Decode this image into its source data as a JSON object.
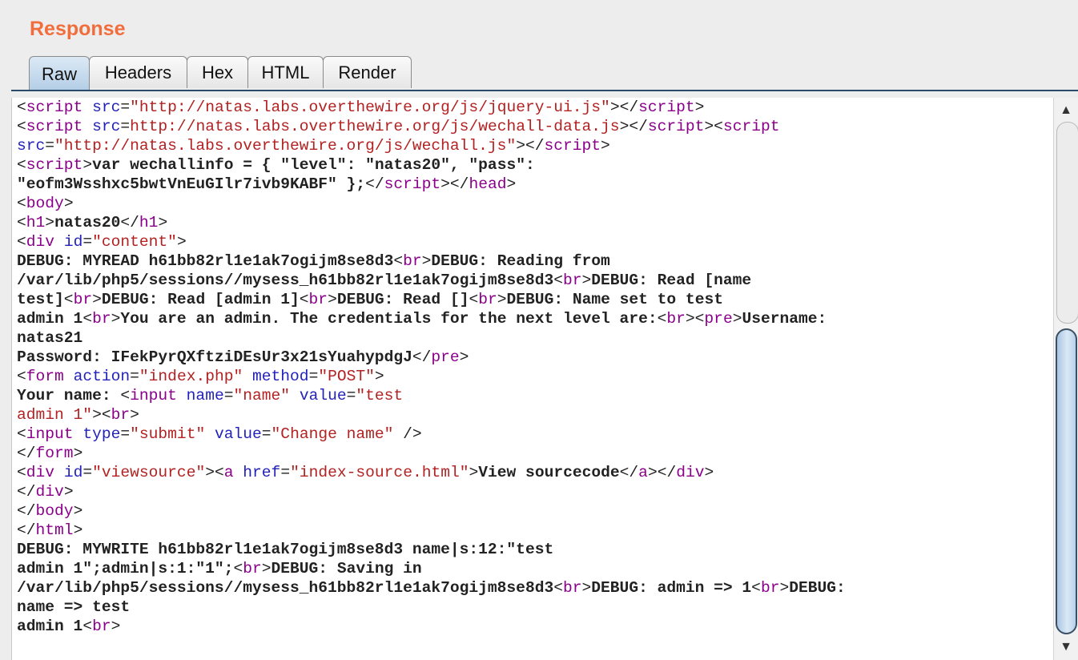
{
  "panel": {
    "title": "Response"
  },
  "tabs": [
    {
      "label": "Raw",
      "active": true
    },
    {
      "label": "Headers",
      "active": false
    },
    {
      "label": "Hex",
      "active": false
    },
    {
      "label": "HTML",
      "active": false
    },
    {
      "label": "Render",
      "active": false
    }
  ],
  "colors": {
    "title": "#f16e3c",
    "tag": "#8b008b",
    "attr": "#2222bb",
    "value": "#b22222",
    "text": "#222222"
  },
  "scrollbar": {
    "up_icon": "▲",
    "down_icon": "▼"
  },
  "code_lines": [
    [
      [
        "p",
        "<"
      ],
      [
        "t",
        "script"
      ],
      [
        "p",
        " "
      ],
      [
        "a",
        "src"
      ],
      [
        "p",
        "="
      ],
      [
        "v",
        "\"http://natas.labs.overthewire.org/js/jquery-ui.js\""
      ],
      [
        "p",
        "></"
      ],
      [
        "t",
        "script"
      ],
      [
        "p",
        ">"
      ]
    ],
    [
      [
        "p",
        "<"
      ],
      [
        "t",
        "script"
      ],
      [
        "p",
        " "
      ],
      [
        "a",
        "src"
      ],
      [
        "p",
        "="
      ],
      [
        "v",
        "http://natas.labs.overthewire.org/js/wechall-data.js"
      ],
      [
        "p",
        "></"
      ],
      [
        "t",
        "script"
      ],
      [
        "p",
        "><"
      ],
      [
        "t",
        "script"
      ]
    ],
    [
      [
        "a",
        "src"
      ],
      [
        "p",
        "="
      ],
      [
        "v",
        "\"http://natas.labs.overthewire.org/js/wechall.js\""
      ],
      [
        "p",
        "></"
      ],
      [
        "t",
        "script"
      ],
      [
        "p",
        ">"
      ]
    ],
    [
      [
        "p",
        "<"
      ],
      [
        "t",
        "script"
      ],
      [
        "p",
        ">"
      ],
      [
        "x",
        "var wechallinfo = { \"level\": \"natas20\", \"pass\":"
      ]
    ],
    [
      [
        "x",
        "\"eofm3Wsshxc5bwtVnEuGIlr7ivb9KABF\" };"
      ],
      [
        "p",
        "</"
      ],
      [
        "t",
        "script"
      ],
      [
        "p",
        "></"
      ],
      [
        "t",
        "head"
      ],
      [
        "p",
        ">"
      ]
    ],
    [
      [
        "p",
        "<"
      ],
      [
        "t",
        "body"
      ],
      [
        "p",
        ">"
      ]
    ],
    [
      [
        "p",
        "<"
      ],
      [
        "t",
        "h1"
      ],
      [
        "p",
        ">"
      ],
      [
        "x",
        "natas20"
      ],
      [
        "p",
        "</"
      ],
      [
        "t",
        "h1"
      ],
      [
        "p",
        ">"
      ]
    ],
    [
      [
        "p",
        "<"
      ],
      [
        "t",
        "div"
      ],
      [
        "p",
        " "
      ],
      [
        "a",
        "id"
      ],
      [
        "p",
        "="
      ],
      [
        "v",
        "\"content\""
      ],
      [
        "p",
        ">"
      ]
    ],
    [
      [
        "x",
        "DEBUG: MYREAD h61bb82rl1e1ak7ogijm8se8d3"
      ],
      [
        "p",
        "<"
      ],
      [
        "t",
        "br"
      ],
      [
        "p",
        ">"
      ],
      [
        "x",
        "DEBUG: Reading from"
      ]
    ],
    [
      [
        "x",
        "/var/lib/php5/sessions//mysess_h61bb82rl1e1ak7ogijm8se8d3"
      ],
      [
        "p",
        "<"
      ],
      [
        "t",
        "br"
      ],
      [
        "p",
        ">"
      ],
      [
        "x",
        "DEBUG: Read [name"
      ]
    ],
    [
      [
        "x",
        "test]"
      ],
      [
        "p",
        "<"
      ],
      [
        "t",
        "br"
      ],
      [
        "p",
        ">"
      ],
      [
        "x",
        "DEBUG: Read [admin 1]"
      ],
      [
        "p",
        "<"
      ],
      [
        "t",
        "br"
      ],
      [
        "p",
        ">"
      ],
      [
        "x",
        "DEBUG: Read []"
      ],
      [
        "p",
        "<"
      ],
      [
        "t",
        "br"
      ],
      [
        "p",
        ">"
      ],
      [
        "x",
        "DEBUG: Name set to test"
      ]
    ],
    [
      [
        "x",
        "admin 1"
      ],
      [
        "p",
        "<"
      ],
      [
        "t",
        "br"
      ],
      [
        "p",
        ">"
      ],
      [
        "x",
        "You are an admin. The credentials for the next level are:"
      ],
      [
        "p",
        "<"
      ],
      [
        "t",
        "br"
      ],
      [
        "p",
        "><"
      ],
      [
        "t",
        "pre"
      ],
      [
        "p",
        ">"
      ],
      [
        "x",
        "Username:"
      ]
    ],
    [
      [
        "x",
        "natas21"
      ]
    ],
    [
      [
        "x",
        "Password: IFekPyrQXftziDEsUr3x21sYuahypdgJ"
      ],
      [
        "p",
        "</"
      ],
      [
        "t",
        "pre"
      ],
      [
        "p",
        ">"
      ]
    ],
    [
      [
        "p",
        "<"
      ],
      [
        "t",
        "form"
      ],
      [
        "p",
        " "
      ],
      [
        "a",
        "action"
      ],
      [
        "p",
        "="
      ],
      [
        "v",
        "\"index.php\""
      ],
      [
        "p",
        " "
      ],
      [
        "a",
        "method"
      ],
      [
        "p",
        "="
      ],
      [
        "v",
        "\"POST\""
      ],
      [
        "p",
        ">"
      ]
    ],
    [
      [
        "x",
        "Your name: "
      ],
      [
        "p",
        "<"
      ],
      [
        "t",
        "input"
      ],
      [
        "p",
        " "
      ],
      [
        "a",
        "name"
      ],
      [
        "p",
        "="
      ],
      [
        "v",
        "\"name\""
      ],
      [
        "p",
        " "
      ],
      [
        "a",
        "value"
      ],
      [
        "p",
        "="
      ],
      [
        "v",
        "\"test"
      ]
    ],
    [
      [
        "v",
        "admin 1\""
      ],
      [
        "p",
        "><"
      ],
      [
        "t",
        "br"
      ],
      [
        "p",
        ">"
      ]
    ],
    [
      [
        "p",
        "<"
      ],
      [
        "t",
        "input"
      ],
      [
        "p",
        " "
      ],
      [
        "a",
        "type"
      ],
      [
        "p",
        "="
      ],
      [
        "v",
        "\"submit\""
      ],
      [
        "p",
        " "
      ],
      [
        "a",
        "value"
      ],
      [
        "p",
        "="
      ],
      [
        "v",
        "\"Change name\""
      ],
      [
        "p",
        " />"
      ]
    ],
    [
      [
        "p",
        "</"
      ],
      [
        "t",
        "form"
      ],
      [
        "p",
        ">"
      ]
    ],
    [
      [
        "p",
        "<"
      ],
      [
        "t",
        "div"
      ],
      [
        "p",
        " "
      ],
      [
        "a",
        "id"
      ],
      [
        "p",
        "="
      ],
      [
        "v",
        "\"viewsource\""
      ],
      [
        "p",
        "><"
      ],
      [
        "t",
        "a"
      ],
      [
        "p",
        " "
      ],
      [
        "a",
        "href"
      ],
      [
        "p",
        "="
      ],
      [
        "v",
        "\"index-source.html\""
      ],
      [
        "p",
        ">"
      ],
      [
        "x",
        "View sourcecode"
      ],
      [
        "p",
        "</"
      ],
      [
        "t",
        "a"
      ],
      [
        "p",
        "></"
      ],
      [
        "t",
        "div"
      ],
      [
        "p",
        ">"
      ]
    ],
    [
      [
        "p",
        "</"
      ],
      [
        "t",
        "div"
      ],
      [
        "p",
        ">"
      ]
    ],
    [
      [
        "p",
        "</"
      ],
      [
        "t",
        "body"
      ],
      [
        "p",
        ">"
      ]
    ],
    [
      [
        "p",
        "</"
      ],
      [
        "t",
        "html"
      ],
      [
        "p",
        ">"
      ]
    ],
    [
      [
        "x",
        "DEBUG: MYWRITE h61bb82rl1e1ak7ogijm8se8d3 name|s:12:\"test"
      ]
    ],
    [
      [
        "x",
        "admin 1\";admin|s:1:\"1\";"
      ],
      [
        "p",
        "<"
      ],
      [
        "t",
        "br"
      ],
      [
        "p",
        ">"
      ],
      [
        "x",
        "DEBUG: Saving in"
      ]
    ],
    [
      [
        "x",
        "/var/lib/php5/sessions//mysess_h61bb82rl1e1ak7ogijm8se8d3"
      ],
      [
        "p",
        "<"
      ],
      [
        "t",
        "br"
      ],
      [
        "p",
        ">"
      ],
      [
        "x",
        "DEBUG: admin => 1"
      ],
      [
        "p",
        "<"
      ],
      [
        "t",
        "br"
      ],
      [
        "p",
        ">"
      ],
      [
        "x",
        "DEBUG:"
      ]
    ],
    [
      [
        "x",
        "name => test"
      ]
    ],
    [
      [
        "x",
        "admin 1"
      ],
      [
        "p",
        "<"
      ],
      [
        "t",
        "br"
      ],
      [
        "p",
        ">"
      ]
    ]
  ]
}
